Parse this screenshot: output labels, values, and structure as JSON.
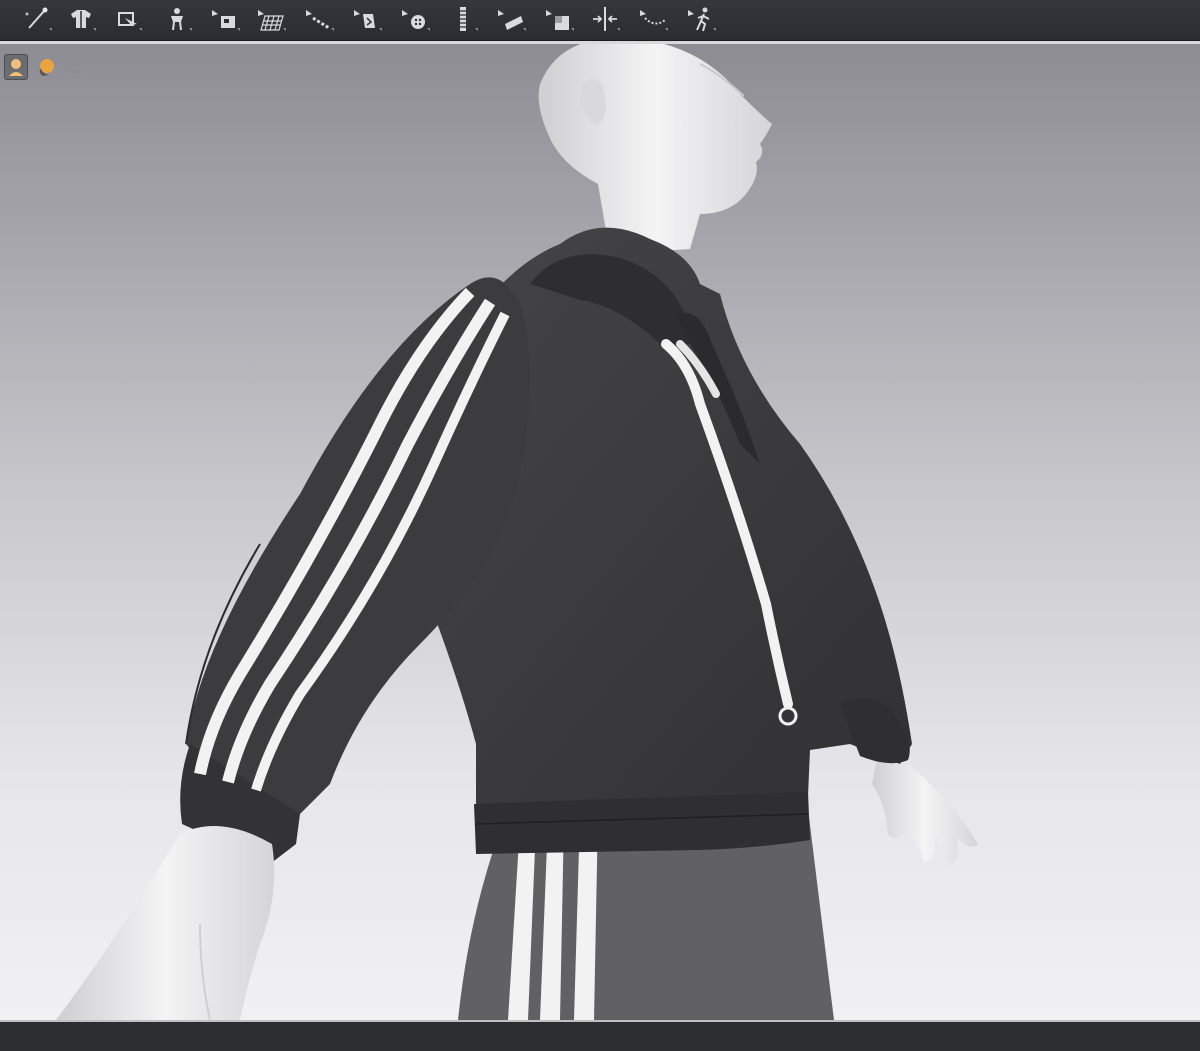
{
  "toolbar": {
    "tools": [
      {
        "name": "pin-tool",
        "icon": "pin-icon"
      },
      {
        "name": "garment-tool",
        "icon": "garment-icon"
      },
      {
        "name": "transform-tool",
        "icon": "transform-icon"
      },
      {
        "name": "avatar-tool",
        "icon": "avatar-icon"
      },
      {
        "name": "edit-texture-tool",
        "icon": "texture-icon"
      },
      {
        "name": "mesh-tool",
        "icon": "mesh-icon"
      },
      {
        "name": "topstitch-tool",
        "icon": "topstitch-icon"
      },
      {
        "name": "graphic-tool",
        "icon": "graphic-icon"
      },
      {
        "name": "button-tool",
        "icon": "button-icon"
      },
      {
        "name": "zipper-tool",
        "icon": "zipper-icon"
      },
      {
        "name": "tape-tool",
        "icon": "tape-icon"
      },
      {
        "name": "trim-tool",
        "icon": "trim-icon"
      },
      {
        "name": "measure-tool",
        "icon": "measure-icon"
      },
      {
        "name": "ruler-tool",
        "icon": "ruler-icon"
      },
      {
        "name": "walk-tool",
        "icon": "walk-icon"
      }
    ]
  },
  "viewport": {
    "tools": [
      {
        "name": "show-avatar-toggle",
        "icon": "avatar-head-icon",
        "active": true
      },
      {
        "name": "avatar-display-toggle",
        "icon": "avatar-shaded-icon",
        "active": false
      },
      {
        "name": "surface-toggle",
        "icon": "surface-icon",
        "active": false
      }
    ]
  },
  "colors": {
    "garment": "#3a3a3c",
    "pants": "#606062",
    "stripe": "#f2f2f2",
    "avatar": "#ededed"
  }
}
